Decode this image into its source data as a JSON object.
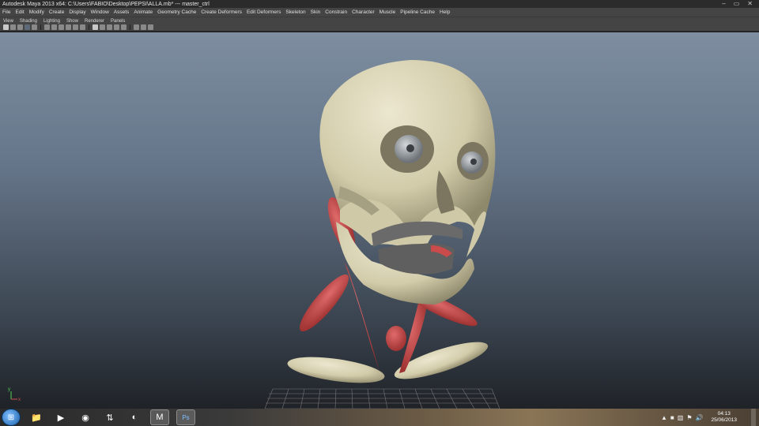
{
  "window": {
    "title": "Autodesk Maya 2013 x64: C:\\Users\\FABIO\\Desktop\\PEPSI\\ALLA.mb*   ---   master_ctrl",
    "minimize": "‒",
    "maximize": "▭",
    "close": "✕"
  },
  "menubar": {
    "items": [
      "File",
      "Edit",
      "Modify",
      "Create",
      "Display",
      "Window",
      "Assets",
      "Animate",
      "Geometry Cache",
      "Create Deformers",
      "Edit Deformers",
      "Skeleton",
      "Skin",
      "Constrain",
      "Character",
      "Muscle",
      "Pipeline Cache",
      "Help"
    ]
  },
  "panelmenu": {
    "items": [
      "View",
      "Shading",
      "Lighting",
      "Show",
      "Renderer",
      "Panels"
    ]
  },
  "viewport": {
    "axis_x": "x",
    "axis_y": "y",
    "colors": {
      "bone": "#d8d3b4",
      "muscle": "#c94b4b",
      "teeth": "#6a6a6a",
      "eye": "#9aa0a6"
    }
  },
  "taskbar": {
    "start_icon": "windows-start-icon",
    "apps": [
      {
        "name": "explorer-icon",
        "glyph": "📁"
      },
      {
        "name": "media-player-icon",
        "glyph": "▶"
      },
      {
        "name": "chrome-icon",
        "glyph": "◉"
      },
      {
        "name": "transfer-icon",
        "glyph": "⇅"
      },
      {
        "name": "firefox-icon",
        "glyph": "◐"
      },
      {
        "name": "maya-icon",
        "glyph": "M"
      },
      {
        "name": "photoshop-icon",
        "glyph": "Ps"
      }
    ],
    "time": "04:13",
    "date": "25/06/2013",
    "tray_up": "▲",
    "tray_volume": "🔊"
  }
}
